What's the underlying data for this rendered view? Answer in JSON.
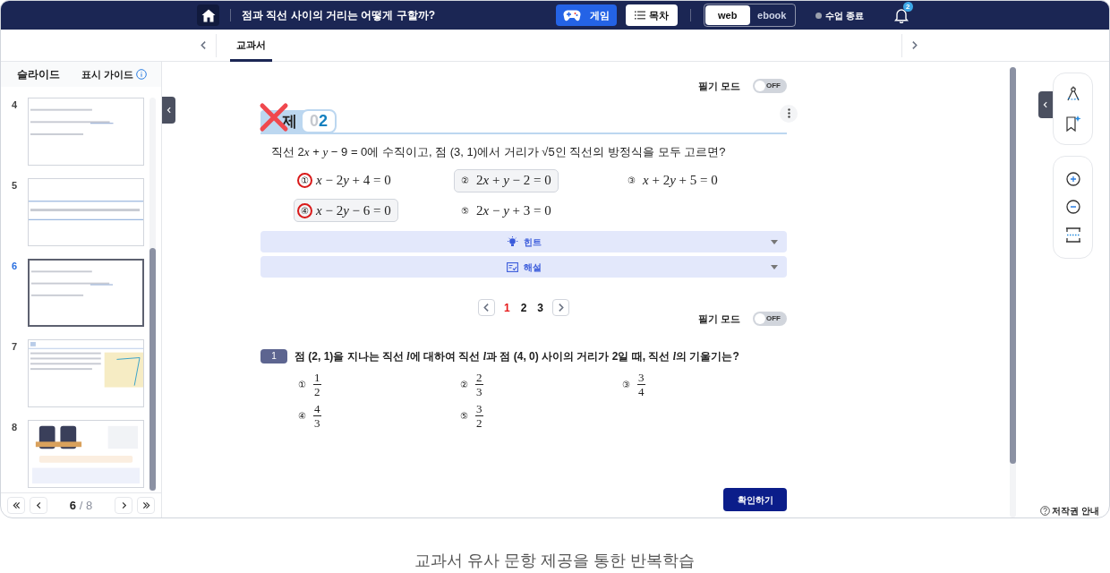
{
  "top_bar": {
    "title": "점과 직선 사이의 거리는 어떻게 구할까?",
    "game_button": "게임",
    "toc_button": "목차",
    "view_modes": [
      {
        "label": "web",
        "selected": true
      },
      {
        "label": "ebook",
        "selected": false
      }
    ],
    "end_class": "수업 종료",
    "notification_count": "2"
  },
  "tabs": [
    {
      "label": "교과서",
      "selected": true
    }
  ],
  "sidebar": {
    "title": "슬라이드",
    "guide": "표시 가이드",
    "slides": [
      {
        "number": "4",
        "selected": false
      },
      {
        "number": "5",
        "selected": false
      },
      {
        "number": "6",
        "selected": true
      },
      {
        "number": "7",
        "selected": false
      },
      {
        "number": "8",
        "selected": false
      }
    ],
    "pager": {
      "current": "6",
      "separator": "/",
      "total": "8"
    }
  },
  "handwriting_toggles": [
    {
      "label": "필기 모드",
      "on": false,
      "state_text": "OFF"
    },
    {
      "label": "필기 모드",
      "on": false,
      "state_text": "OFF"
    }
  ],
  "example": {
    "badge": "제",
    "number": "02",
    "wrong": true,
    "question": "직선 2x + y − 9 = 0에 수직이고, 점 (3, 1)에서 거리가 √5인 직선의 방정식을 모두 고르면?",
    "choices": [
      {
        "marker": "①",
        "text": "x − 2y + 4 = 0",
        "circled": true,
        "highlighted": false
      },
      {
        "marker": "②",
        "text": "2x + y − 2 = 0",
        "circled": false,
        "highlighted": true
      },
      {
        "marker": "③",
        "text": "x + 2y + 5 = 0",
        "circled": false,
        "highlighted": false
      },
      {
        "marker": "④",
        "text": "x − 2y − 6 = 0",
        "circled": true,
        "highlighted": true
      },
      {
        "marker": "⑤",
        "text": "2x − y + 3 = 0",
        "circled": false,
        "highlighted": false
      }
    ],
    "panels": [
      {
        "kind": "hint",
        "label": "힌트",
        "expanded": false
      },
      {
        "kind": "explanation",
        "label": "해설",
        "expanded": false
      }
    ]
  },
  "pages": [
    {
      "label": "1",
      "selected": true
    },
    {
      "label": "2",
      "selected": false
    },
    {
      "label": "3",
      "selected": false
    }
  ],
  "problem": {
    "number": "1",
    "question": "점 (2,  1)을 지나는 직선 l에 대하여 직선 l과 점 (4,  0) 사이의 거리가 2일 때, 직선 l의 기울기는?",
    "choices": [
      {
        "marker": "①",
        "numerator": "1",
        "denominator": "2"
      },
      {
        "marker": "②",
        "numerator": "2",
        "denominator": "3"
      },
      {
        "marker": "③",
        "numerator": "3",
        "denominator": "4"
      },
      {
        "marker": "④",
        "numerator": "4",
        "denominator": "3"
      },
      {
        "marker": "⑤",
        "numerator": "3",
        "denominator": "2"
      }
    ],
    "confirm_button": "확인하기"
  },
  "copyright": "저작권 안내",
  "caption": "교과서 유사 문항 제공을 통한 반복학습"
}
